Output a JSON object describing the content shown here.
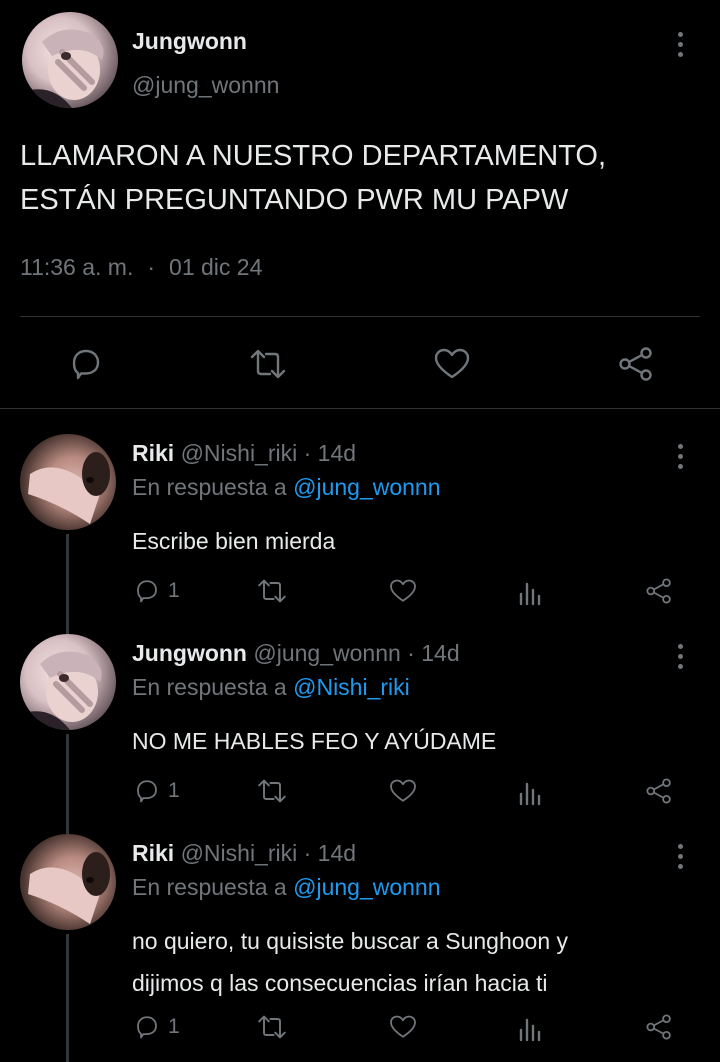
{
  "main_tweet": {
    "name": "Jungwonn",
    "handle": "@jung_wonnn",
    "text_line1": "LLAMARON A NUESTRO DEPARTAMENTO,",
    "text_line2": "ESTÁN PREGUNTANDO PWR MU PAPW",
    "time": "11:36 a. m.",
    "separator": "·",
    "date": "01 dic 24"
  },
  "replies": [
    {
      "name": "Riki",
      "handle": "@Nishi_riki",
      "dot": "·",
      "age": "14d",
      "reply_prefix": "En respuesta a",
      "reply_to": "@jung_wonnn",
      "text_line1": "Escribe bien mierda",
      "text_line2": "",
      "reply_count": "1"
    },
    {
      "name": "Jungwonn",
      "handle": "@jung_wonnn",
      "dot": "·",
      "age": "14d",
      "reply_prefix": "En respuesta a",
      "reply_to": "@Nishi_riki",
      "text_line1": "NO ME HABLES FEO Y AYÚDAME",
      "text_line2": "",
      "reply_count": "1"
    },
    {
      "name": "Riki",
      "handle": "@Nishi_riki",
      "dot": "·",
      "age": "14d",
      "reply_prefix": "En respuesta a",
      "reply_to": "@jung_wonnn",
      "text_line1": "no quiero, tu quisiste buscar a Sunghoon y",
      "text_line2": "dijimos q las consecuencias irían hacia ti",
      "reply_count": "1"
    }
  ],
  "icons": [
    "reply-icon",
    "retweet-icon",
    "like-icon",
    "share-icon",
    "views-icon",
    "more-icon"
  ],
  "colors": {
    "background": "#000000",
    "text": "#e7e9ea",
    "muted": "#71767b",
    "link": "#1d9bf0",
    "divider": "#2f3336"
  }
}
